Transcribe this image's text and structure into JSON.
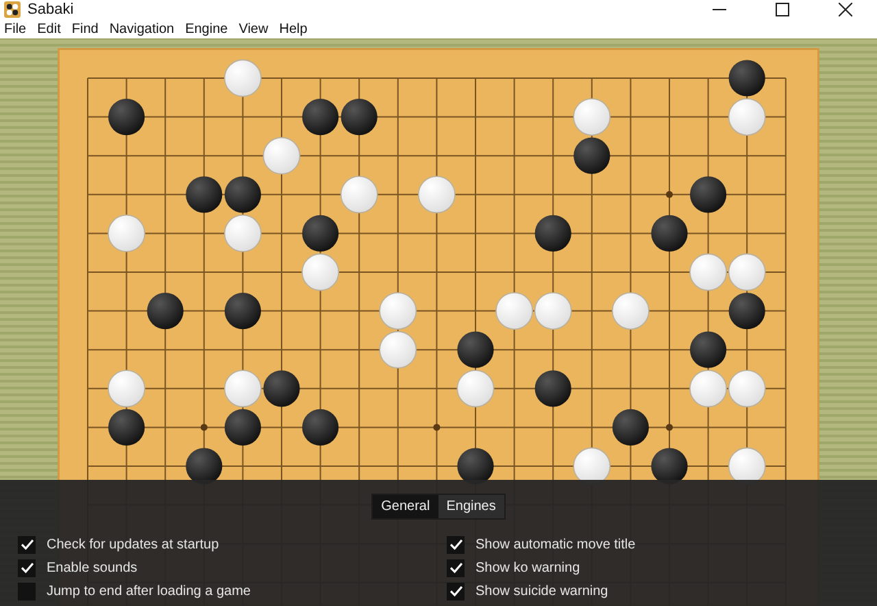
{
  "window": {
    "title": "Sabaki"
  },
  "menu": [
    "File",
    "Edit",
    "Find",
    "Navigation",
    "Engine",
    "View",
    "Help"
  ],
  "board": {
    "rows": [
      [
        {
          "kind": "empty"
        },
        {
          "kind": "empty"
        },
        {
          "kind": "empty"
        },
        {
          "kind": "empty"
        },
        {
          "kind": "white"
        },
        {
          "kind": "empty"
        },
        {
          "kind": "empty"
        },
        {
          "kind": "empty"
        },
        {
          "kind": "empty"
        },
        {
          "kind": "empty"
        },
        {
          "kind": "empty"
        },
        {
          "kind": "empty"
        },
        {
          "kind": "empty"
        },
        {
          "kind": "empty"
        },
        {
          "kind": "empty"
        },
        {
          "kind": "empty"
        },
        {
          "kind": "empty"
        },
        {
          "kind": "black"
        },
        {
          "kind": "empty"
        }
      ],
      [
        {
          "kind": "empty"
        },
        {
          "kind": "black"
        },
        {
          "kind": "empty"
        },
        {
          "kind": "empty"
        },
        {
          "kind": "empty"
        },
        {
          "kind": "empty"
        },
        {
          "kind": "black"
        },
        {
          "kind": "black"
        },
        {
          "kind": "empty"
        },
        {
          "kind": "empty"
        },
        {
          "kind": "empty"
        },
        {
          "kind": "empty"
        },
        {
          "kind": "empty"
        },
        {
          "kind": "white"
        },
        {
          "kind": "empty"
        },
        {
          "kind": "empty"
        },
        {
          "kind": "empty"
        },
        {
          "kind": "white"
        },
        {
          "kind": "empty"
        }
      ],
      [
        {
          "kind": "empty"
        },
        {
          "kind": "empty"
        },
        {
          "kind": "empty"
        },
        {
          "kind": "empty"
        },
        {
          "kind": "empty"
        },
        {
          "kind": "white"
        },
        {
          "kind": "empty"
        },
        {
          "kind": "empty"
        },
        {
          "kind": "empty"
        },
        {
          "kind": "empty"
        },
        {
          "kind": "empty"
        },
        {
          "kind": "empty"
        },
        {
          "kind": "empty"
        },
        {
          "kind": "black"
        },
        {
          "kind": "empty"
        },
        {
          "kind": "empty"
        },
        {
          "kind": "empty"
        },
        {
          "kind": "empty"
        },
        {
          "kind": "empty"
        }
      ],
      [
        {
          "kind": "empty"
        },
        {
          "kind": "empty"
        },
        {
          "kind": "empty"
        },
        {
          "kind": "black"
        },
        {
          "kind": "black"
        },
        {
          "kind": "empty"
        },
        {
          "kind": "empty"
        },
        {
          "kind": "white"
        },
        {
          "kind": "empty"
        },
        {
          "kind": "white"
        },
        {
          "kind": "empty"
        },
        {
          "kind": "empty"
        },
        {
          "kind": "empty"
        },
        {
          "kind": "empty"
        },
        {
          "kind": "empty"
        },
        {
          "kind": "empty"
        },
        {
          "kind": "black"
        },
        {
          "kind": "empty"
        },
        {
          "kind": "empty"
        }
      ],
      [
        {
          "kind": "empty"
        },
        {
          "kind": "white"
        },
        {
          "kind": "empty"
        },
        {
          "kind": "empty"
        },
        {
          "kind": "white"
        },
        {
          "kind": "empty"
        },
        {
          "kind": "black"
        },
        {
          "kind": "empty"
        },
        {
          "kind": "empty"
        },
        {
          "kind": "empty"
        },
        {
          "kind": "empty"
        },
        {
          "kind": "empty"
        },
        {
          "kind": "black"
        },
        {
          "kind": "empty"
        },
        {
          "kind": "empty"
        },
        {
          "kind": "black"
        },
        {
          "kind": "empty"
        },
        {
          "kind": "empty"
        },
        {
          "kind": "empty"
        }
      ],
      [
        {
          "kind": "empty"
        },
        {
          "kind": "empty"
        },
        {
          "kind": "empty"
        },
        {
          "kind": "empty"
        },
        {
          "kind": "empty"
        },
        {
          "kind": "empty"
        },
        {
          "kind": "white"
        },
        {
          "kind": "empty"
        },
        {
          "kind": "empty"
        },
        {
          "kind": "empty"
        },
        {
          "kind": "empty"
        },
        {
          "kind": "empty"
        },
        {
          "kind": "empty"
        },
        {
          "kind": "empty"
        },
        {
          "kind": "empty"
        },
        {
          "kind": "empty"
        },
        {
          "kind": "white"
        },
        {
          "kind": "white"
        },
        {
          "kind": "empty"
        }
      ],
      [
        {
          "kind": "empty"
        },
        {
          "kind": "empty"
        },
        {
          "kind": "black"
        },
        {
          "kind": "empty"
        },
        {
          "kind": "black"
        },
        {
          "kind": "empty"
        },
        {
          "kind": "empty"
        },
        {
          "kind": "empty"
        },
        {
          "kind": "white"
        },
        {
          "kind": "empty"
        },
        {
          "kind": "empty"
        },
        {
          "kind": "white"
        },
        {
          "kind": "white"
        },
        {
          "kind": "empty"
        },
        {
          "kind": "white"
        },
        {
          "kind": "empty"
        },
        {
          "kind": "empty"
        },
        {
          "kind": "black"
        },
        {
          "kind": "empty"
        }
      ],
      [
        {
          "kind": "empty"
        },
        {
          "kind": "empty"
        },
        {
          "kind": "empty"
        },
        {
          "kind": "empty"
        },
        {
          "kind": "empty"
        },
        {
          "kind": "empty"
        },
        {
          "kind": "empty"
        },
        {
          "kind": "empty"
        },
        {
          "kind": "white"
        },
        {
          "kind": "empty"
        },
        {
          "kind": "black"
        },
        {
          "kind": "empty"
        },
        {
          "kind": "empty"
        },
        {
          "kind": "empty"
        },
        {
          "kind": "empty"
        },
        {
          "kind": "empty"
        },
        {
          "kind": "black"
        },
        {
          "kind": "empty"
        },
        {
          "kind": "empty"
        }
      ],
      [
        {
          "kind": "empty"
        },
        {
          "kind": "white"
        },
        {
          "kind": "empty"
        },
        {
          "kind": "empty"
        },
        {
          "kind": "white"
        },
        {
          "kind": "black"
        },
        {
          "kind": "empty"
        },
        {
          "kind": "empty"
        },
        {
          "kind": "empty"
        },
        {
          "kind": "empty"
        },
        {
          "kind": "white"
        },
        {
          "kind": "empty"
        },
        {
          "kind": "black"
        },
        {
          "kind": "empty"
        },
        {
          "kind": "empty"
        },
        {
          "kind": "empty"
        },
        {
          "kind": "white"
        },
        {
          "kind": "white"
        },
        {
          "kind": "empty"
        }
      ],
      [
        {
          "kind": "empty"
        },
        {
          "kind": "black"
        },
        {
          "kind": "empty"
        },
        {
          "kind": "empty"
        },
        {
          "kind": "black"
        },
        {
          "kind": "empty"
        },
        {
          "kind": "black"
        },
        {
          "kind": "empty"
        },
        {
          "kind": "empty"
        },
        {
          "kind": "empty"
        },
        {
          "kind": "empty"
        },
        {
          "kind": "empty"
        },
        {
          "kind": "empty"
        },
        {
          "kind": "empty"
        },
        {
          "kind": "black"
        },
        {
          "kind": "empty"
        },
        {
          "kind": "empty"
        },
        {
          "kind": "empty"
        },
        {
          "kind": "empty"
        }
      ],
      [
        {
          "kind": "empty"
        },
        {
          "kind": "empty"
        },
        {
          "kind": "empty"
        },
        {
          "kind": "black"
        },
        {
          "kind": "empty"
        },
        {
          "kind": "empty"
        },
        {
          "kind": "empty"
        },
        {
          "kind": "empty"
        },
        {
          "kind": "empty"
        },
        {
          "kind": "empty"
        },
        {
          "kind": "black"
        },
        {
          "kind": "empty"
        },
        {
          "kind": "empty"
        },
        {
          "kind": "white"
        },
        {
          "kind": "empty"
        },
        {
          "kind": "black"
        },
        {
          "kind": "empty"
        },
        {
          "kind": "white"
        },
        {
          "kind": "empty"
        }
      ]
    ]
  },
  "preferences": {
    "tabs": [
      {
        "label": "General",
        "selected": true
      },
      {
        "label": "Engines",
        "selected": false
      }
    ],
    "columns": [
      [
        {
          "label": "Check for updates at startup",
          "checked": true
        },
        {
          "label": "Enable sounds",
          "checked": true
        },
        {
          "label": "Jump to end after loading a game",
          "checked": false
        }
      ],
      [
        {
          "label": "Show automatic move title",
          "checked": true
        },
        {
          "label": "Show ko warning",
          "checked": true
        },
        {
          "label": "Show suicide warning",
          "checked": true
        }
      ]
    ]
  }
}
